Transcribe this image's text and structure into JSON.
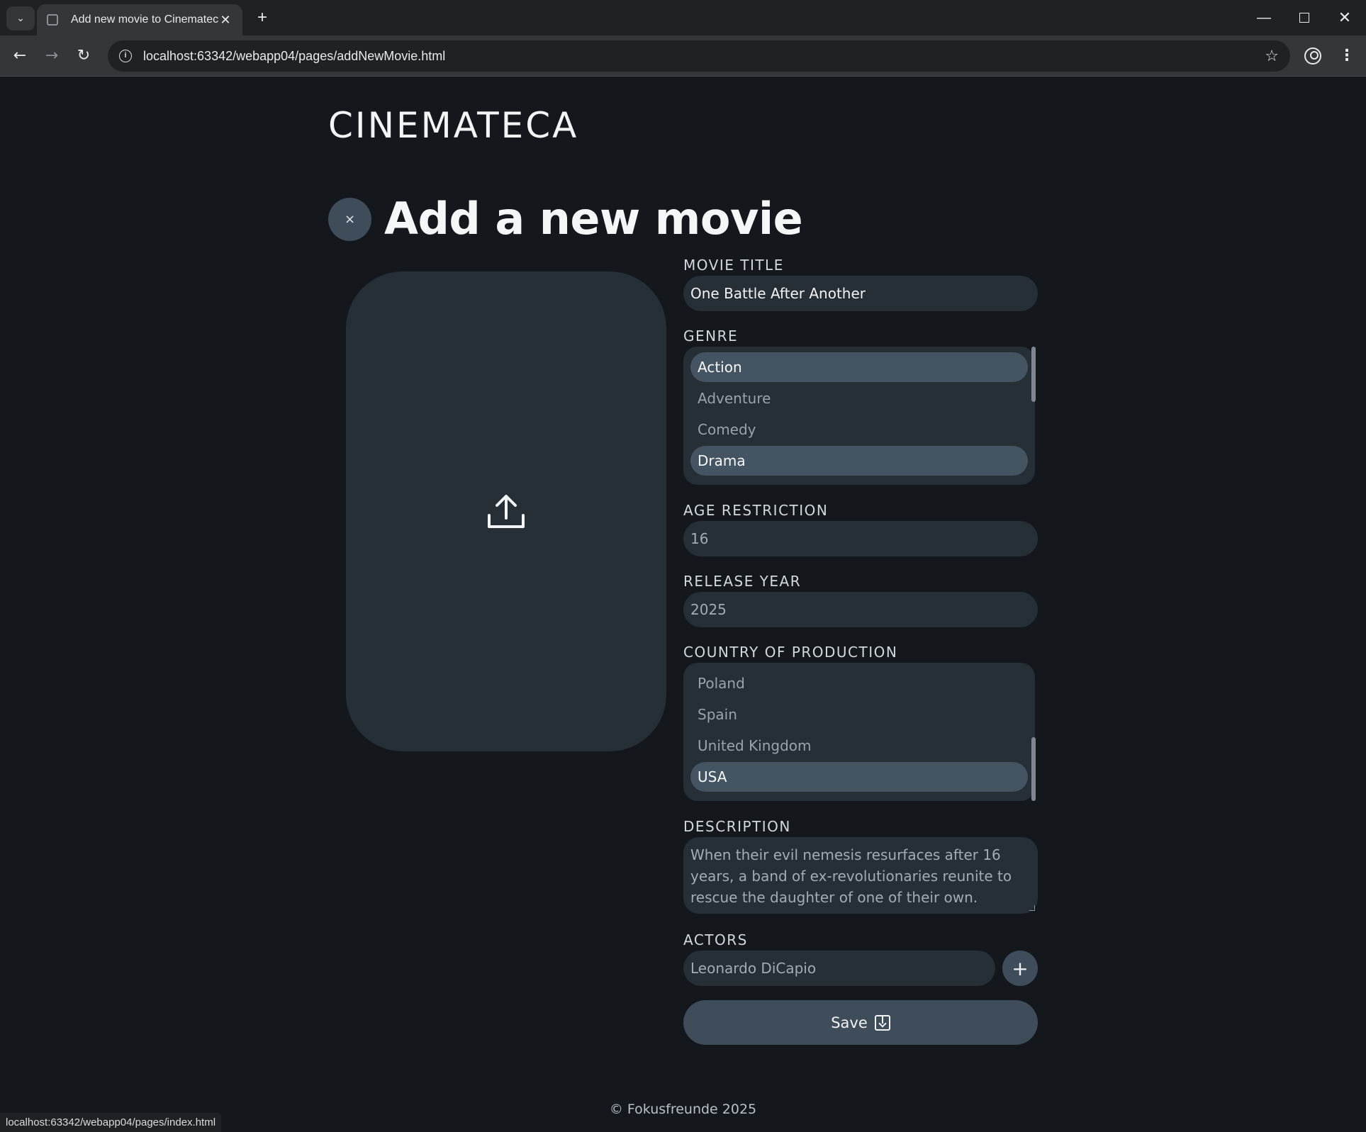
{
  "browser": {
    "tab_title": "Add new movie to Cinemateca",
    "url": "localhost:63342/webapp04/pages/addNewMovie.html",
    "status_url": "localhost:63342/webapp04/pages/index.html",
    "tab_search_glyph": "⌄",
    "tab_close_glyph": "✕",
    "new_tab_glyph": "+",
    "back_glyph": "←",
    "forward_glyph": "→",
    "reload_glyph": "↻",
    "info_glyph": "i",
    "star_glyph": "☆",
    "menu_glyph": "⋮",
    "minimize_glyph": "—",
    "close_glyph": "✕"
  },
  "header": {
    "brand": "CINEMATECA",
    "close_glyph": "×",
    "title": "Add a new movie"
  },
  "form": {
    "movie_title": {
      "label": "MOVIE TITLE",
      "value": "One Battle After Another"
    },
    "genre": {
      "label": "GENRE",
      "options": [
        {
          "label": "Action",
          "selected": true
        },
        {
          "label": "Adventure",
          "selected": false
        },
        {
          "label": "Comedy",
          "selected": false
        },
        {
          "label": "Drama",
          "selected": true
        }
      ]
    },
    "age_restriction": {
      "label": "AGE RESTRICTION",
      "value": "16"
    },
    "release_year": {
      "label": "RELEASE YEAR",
      "value": "2025"
    },
    "country": {
      "label": "COUNTRY OF PRODUCTION",
      "options": [
        {
          "label": "Poland",
          "selected": false
        },
        {
          "label": "Spain",
          "selected": false
        },
        {
          "label": "United Kingdom",
          "selected": false
        },
        {
          "label": "USA",
          "selected": true
        }
      ]
    },
    "description": {
      "label": "DESCRIPTION",
      "value": "When their evil nemesis resurfaces after 16 years, a band of ex-revolutionaries reunite to rescue the daughter of one of their own."
    },
    "actors": {
      "label": "ACTORS",
      "value": "Leonardo DiCapio",
      "add_glyph": "+"
    },
    "save_label": "Save"
  },
  "footer": {
    "text": "© Fokusfreunde 2025"
  },
  "icons": {
    "upload": "upload-icon",
    "save": "save-icon",
    "add": "plus-icon"
  },
  "colors": {
    "page_bg": "#14181d",
    "panel_bg": "#262e36",
    "accent": "#3f4d5a",
    "selected_option": "#455463"
  }
}
